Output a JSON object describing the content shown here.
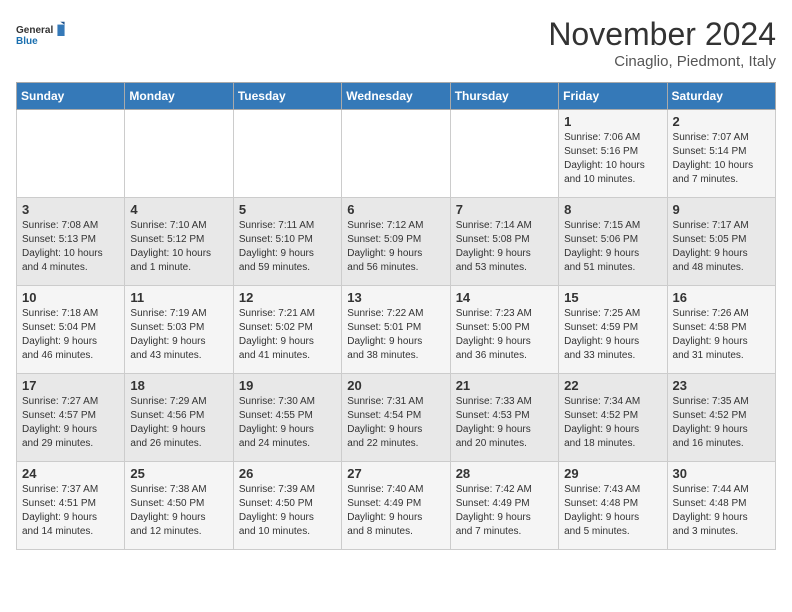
{
  "header": {
    "logo_line1": "General",
    "logo_line2": "Blue",
    "month": "November 2024",
    "location": "Cinaglio, Piedmont, Italy"
  },
  "weekdays": [
    "Sunday",
    "Monday",
    "Tuesday",
    "Wednesday",
    "Thursday",
    "Friday",
    "Saturday"
  ],
  "weeks": [
    [
      {
        "day": "",
        "info": ""
      },
      {
        "day": "",
        "info": ""
      },
      {
        "day": "",
        "info": ""
      },
      {
        "day": "",
        "info": ""
      },
      {
        "day": "",
        "info": ""
      },
      {
        "day": "1",
        "info": "Sunrise: 7:06 AM\nSunset: 5:16 PM\nDaylight: 10 hours\nand 10 minutes."
      },
      {
        "day": "2",
        "info": "Sunrise: 7:07 AM\nSunset: 5:14 PM\nDaylight: 10 hours\nand 7 minutes."
      }
    ],
    [
      {
        "day": "3",
        "info": "Sunrise: 7:08 AM\nSunset: 5:13 PM\nDaylight: 10 hours\nand 4 minutes."
      },
      {
        "day": "4",
        "info": "Sunrise: 7:10 AM\nSunset: 5:12 PM\nDaylight: 10 hours\nand 1 minute."
      },
      {
        "day": "5",
        "info": "Sunrise: 7:11 AM\nSunset: 5:10 PM\nDaylight: 9 hours\nand 59 minutes."
      },
      {
        "day": "6",
        "info": "Sunrise: 7:12 AM\nSunset: 5:09 PM\nDaylight: 9 hours\nand 56 minutes."
      },
      {
        "day": "7",
        "info": "Sunrise: 7:14 AM\nSunset: 5:08 PM\nDaylight: 9 hours\nand 53 minutes."
      },
      {
        "day": "8",
        "info": "Sunrise: 7:15 AM\nSunset: 5:06 PM\nDaylight: 9 hours\nand 51 minutes."
      },
      {
        "day": "9",
        "info": "Sunrise: 7:17 AM\nSunset: 5:05 PM\nDaylight: 9 hours\nand 48 minutes."
      }
    ],
    [
      {
        "day": "10",
        "info": "Sunrise: 7:18 AM\nSunset: 5:04 PM\nDaylight: 9 hours\nand 46 minutes."
      },
      {
        "day": "11",
        "info": "Sunrise: 7:19 AM\nSunset: 5:03 PM\nDaylight: 9 hours\nand 43 minutes."
      },
      {
        "day": "12",
        "info": "Sunrise: 7:21 AM\nSunset: 5:02 PM\nDaylight: 9 hours\nand 41 minutes."
      },
      {
        "day": "13",
        "info": "Sunrise: 7:22 AM\nSunset: 5:01 PM\nDaylight: 9 hours\nand 38 minutes."
      },
      {
        "day": "14",
        "info": "Sunrise: 7:23 AM\nSunset: 5:00 PM\nDaylight: 9 hours\nand 36 minutes."
      },
      {
        "day": "15",
        "info": "Sunrise: 7:25 AM\nSunset: 4:59 PM\nDaylight: 9 hours\nand 33 minutes."
      },
      {
        "day": "16",
        "info": "Sunrise: 7:26 AM\nSunset: 4:58 PM\nDaylight: 9 hours\nand 31 minutes."
      }
    ],
    [
      {
        "day": "17",
        "info": "Sunrise: 7:27 AM\nSunset: 4:57 PM\nDaylight: 9 hours\nand 29 minutes."
      },
      {
        "day": "18",
        "info": "Sunrise: 7:29 AM\nSunset: 4:56 PM\nDaylight: 9 hours\nand 26 minutes."
      },
      {
        "day": "19",
        "info": "Sunrise: 7:30 AM\nSunset: 4:55 PM\nDaylight: 9 hours\nand 24 minutes."
      },
      {
        "day": "20",
        "info": "Sunrise: 7:31 AM\nSunset: 4:54 PM\nDaylight: 9 hours\nand 22 minutes."
      },
      {
        "day": "21",
        "info": "Sunrise: 7:33 AM\nSunset: 4:53 PM\nDaylight: 9 hours\nand 20 minutes."
      },
      {
        "day": "22",
        "info": "Sunrise: 7:34 AM\nSunset: 4:52 PM\nDaylight: 9 hours\nand 18 minutes."
      },
      {
        "day": "23",
        "info": "Sunrise: 7:35 AM\nSunset: 4:52 PM\nDaylight: 9 hours\nand 16 minutes."
      }
    ],
    [
      {
        "day": "24",
        "info": "Sunrise: 7:37 AM\nSunset: 4:51 PM\nDaylight: 9 hours\nand 14 minutes."
      },
      {
        "day": "25",
        "info": "Sunrise: 7:38 AM\nSunset: 4:50 PM\nDaylight: 9 hours\nand 12 minutes."
      },
      {
        "day": "26",
        "info": "Sunrise: 7:39 AM\nSunset: 4:50 PM\nDaylight: 9 hours\nand 10 minutes."
      },
      {
        "day": "27",
        "info": "Sunrise: 7:40 AM\nSunset: 4:49 PM\nDaylight: 9 hours\nand 8 minutes."
      },
      {
        "day": "28",
        "info": "Sunrise: 7:42 AM\nSunset: 4:49 PM\nDaylight: 9 hours\nand 7 minutes."
      },
      {
        "day": "29",
        "info": "Sunrise: 7:43 AM\nSunset: 4:48 PM\nDaylight: 9 hours\nand 5 minutes."
      },
      {
        "day": "30",
        "info": "Sunrise: 7:44 AM\nSunset: 4:48 PM\nDaylight: 9 hours\nand 3 minutes."
      }
    ]
  ]
}
